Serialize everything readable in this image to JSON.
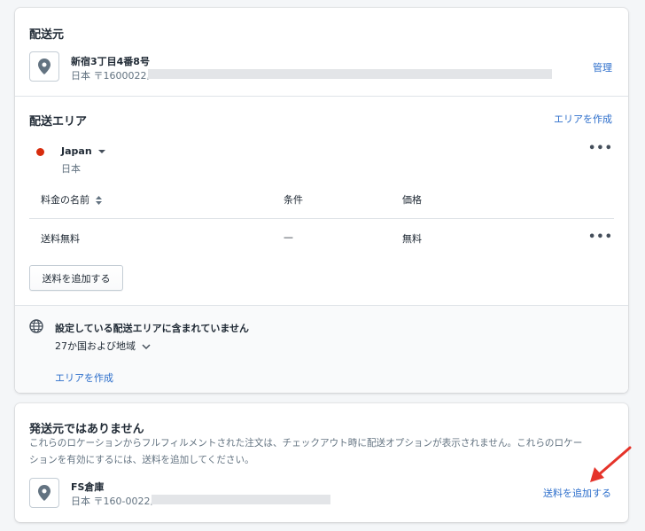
{
  "origin": {
    "title": "配送元",
    "location_name": "新宿3丁目4番8号",
    "address": "日本 〒1600022,",
    "manage_link": "管理"
  },
  "zone": {
    "title": "配送エリア",
    "create_link": "エリアを作成",
    "country_name": "Japan",
    "country_sub": "日本",
    "status_color": "#d72c0d",
    "columns": {
      "name": "料金の名前",
      "condition": "条件",
      "price": "価格"
    },
    "rows": [
      {
        "name": "送料無料",
        "condition": "—",
        "price": "無料"
      }
    ],
    "add_rate_button": "送料を追加する"
  },
  "not_covered": {
    "title": "設定している配送エリアに含まれていません",
    "countries": "27か国および地域",
    "create_link": "エリアを作成"
  },
  "not_origin": {
    "title": "発送元ではありません",
    "description_line1": "これらのロケーションからフルフィルメントされた注文は、チェックアウト時に配送オプションが表示されません。これらのロケー",
    "description_line2": "ションを有効にするには、送料を追加してください。",
    "location_name": "FS倉庫",
    "address": "日本 〒160-0022,",
    "add_rate_link": "送料を追加する",
    "arrow_color": "#e5332a"
  }
}
